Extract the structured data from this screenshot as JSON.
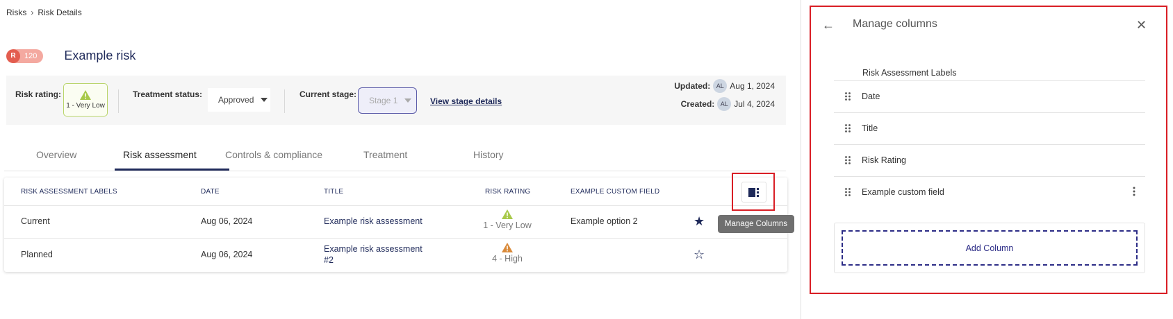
{
  "breadcrumb": {
    "parent": "Risks",
    "current": "Risk Details"
  },
  "risk": {
    "badge_letter": "R",
    "badge_number": "120",
    "title": "Example risk"
  },
  "summary": {
    "risk_rating_label": "Risk rating:",
    "risk_rating_value": "1 - Very Low",
    "treatment_status_label": "Treatment status:",
    "treatment_status_value": "Approved",
    "current_stage_label": "Current stage:",
    "current_stage_value": "Stage 1",
    "view_stage_details": "View stage details",
    "updated_label": "Updated:",
    "updated_avatar": "AL",
    "updated_date": "Aug 1, 2024",
    "created_label": "Created:",
    "created_avatar": "AL",
    "created_date": "Jul 4, 2024"
  },
  "tabs": [
    {
      "label": "Overview"
    },
    {
      "label": "Risk assessment"
    },
    {
      "label": "Controls & compliance"
    },
    {
      "label": "Treatment"
    },
    {
      "label": "History"
    }
  ],
  "table": {
    "headers": [
      "RISK ASSESSMENT LABELS",
      "DATE",
      "TITLE",
      "RISK RATING",
      "EXAMPLE CUSTOM FIELD"
    ],
    "rows": [
      {
        "label": "Current",
        "date": "Aug 06, 2024",
        "title": "Example risk assessment",
        "rating": "1 - Very Low",
        "custom": "Example option 2",
        "starred": true
      },
      {
        "label": "Planned",
        "date": "Aug 06, 2024",
        "title_line1": "Example risk assessment",
        "title_line2": "#2",
        "rating": "4 - High",
        "custom": "",
        "starred": false
      }
    ],
    "tooltip": "Manage Columns"
  },
  "panel": {
    "title": "Manage columns",
    "first_column": "Risk Assessment Labels",
    "columns": [
      {
        "name": "Date"
      },
      {
        "name": "Title"
      },
      {
        "name": "Risk Rating"
      },
      {
        "name": "Example custom field"
      }
    ],
    "add_column": "Add Column"
  },
  "colors": {
    "navy": "#1f2a5a",
    "highlight_red": "#d91e25",
    "very_low_green": "#a8c94a",
    "high_orange": "#d98a3a"
  },
  "icons": [
    "chevron-right-icon",
    "warning-triangle-icon",
    "caret-down-icon",
    "manage-columns-icon",
    "star-filled-icon",
    "star-outline-icon",
    "arrow-left-icon",
    "close-icon",
    "drag-handle-icon",
    "more-vertical-icon"
  ]
}
